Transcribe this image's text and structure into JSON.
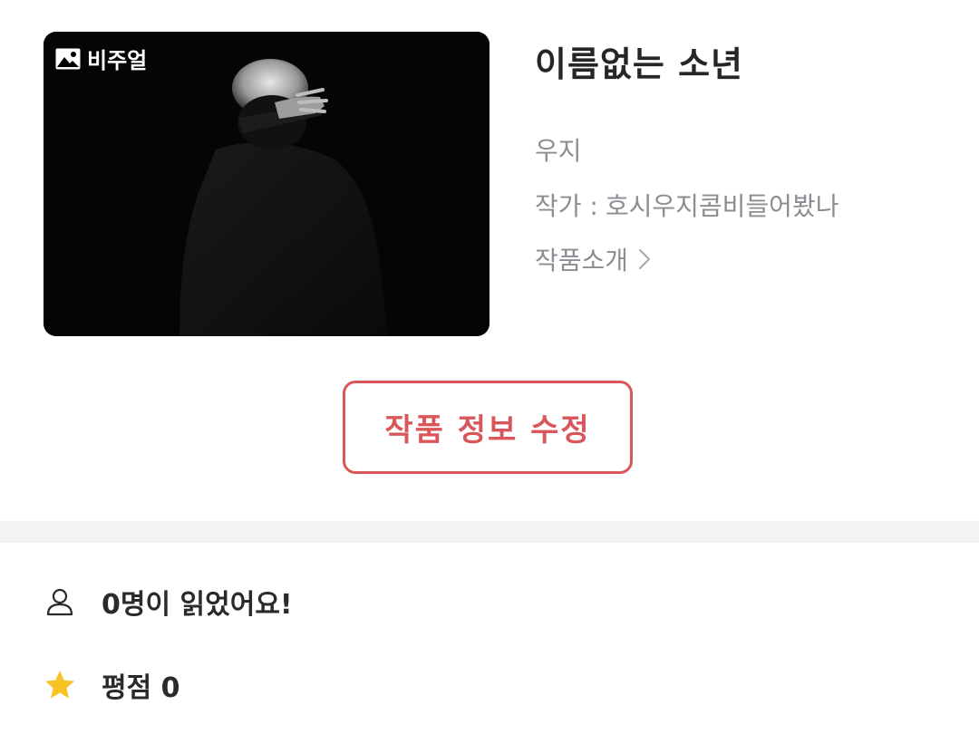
{
  "work": {
    "visual_badge": "비주얼",
    "title": "이름없는 소년",
    "genre": "우지",
    "author_label": "작가 :",
    "author_name": "호시우지콤비들어봤나",
    "intro_label": "작품소개"
  },
  "actions": {
    "edit_label": "작품 정보 수정"
  },
  "stats": {
    "readers_text": "0명이 읽었어요!",
    "rating_text": "평점 0"
  },
  "colors": {
    "accent": "#d9575a",
    "muted_text": "#8a8d92",
    "star": "#f7c325"
  }
}
